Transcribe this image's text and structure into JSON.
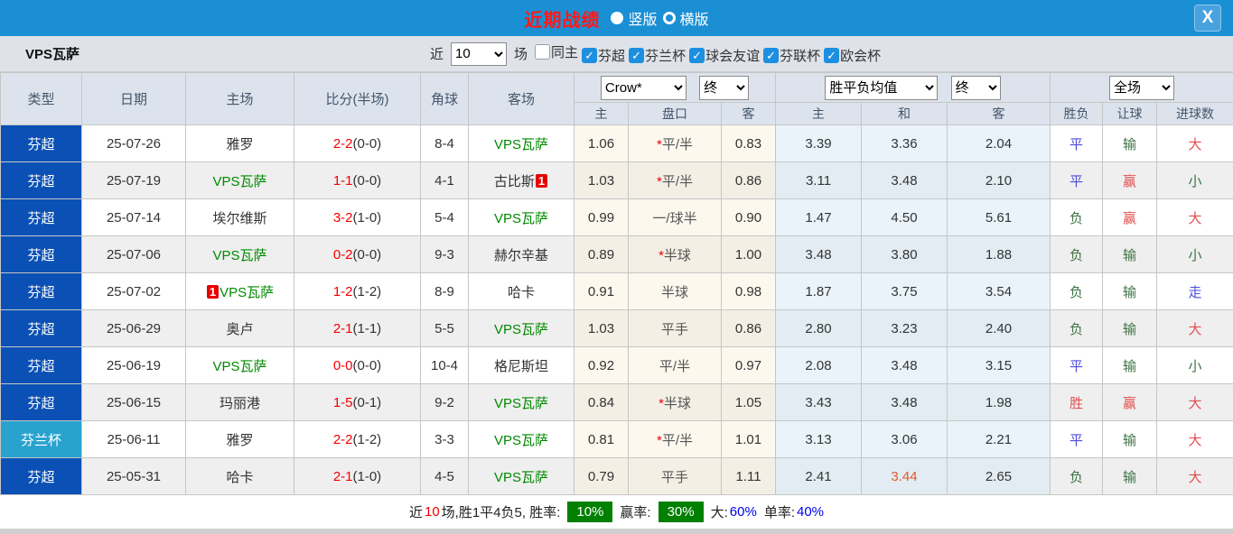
{
  "titlebar": {
    "title": "近期战绩",
    "view_options": [
      {
        "label": "竖版",
        "selected": true
      },
      {
        "label": "横版",
        "selected": false
      }
    ],
    "close_label": "X"
  },
  "filterbar": {
    "team_name": "VPS瓦萨",
    "recent_label": "近",
    "recent_count": "10",
    "matches_label": "场",
    "filters": [
      {
        "label": "同主",
        "checked": false
      },
      {
        "label": "芬超",
        "checked": true
      },
      {
        "label": "芬兰杯",
        "checked": true
      },
      {
        "label": "球会友谊",
        "checked": true
      },
      {
        "label": "芬联杯",
        "checked": true
      },
      {
        "label": "欧会杯",
        "checked": true
      }
    ]
  },
  "table": {
    "left_headers": [
      "类型",
      "日期",
      "主场",
      "比分(半场)",
      "角球",
      "客场"
    ],
    "selects": {
      "odds_company": "Crow*",
      "odds_time": "终",
      "avg": "胜平负均值",
      "avg_time": "终",
      "scope": "全场"
    },
    "sub_headers": [
      "主",
      "盘口",
      "客",
      "主",
      "和",
      "客",
      "胜负",
      "让球",
      "进球数"
    ],
    "rows": [
      {
        "league": "芬超",
        "league_color": "blue",
        "date": "25-07-26",
        "home": {
          "name": "雅罗",
          "is_team": false
        },
        "score": "2-2",
        "half": "(0-0)",
        "corners": "8-4",
        "away": {
          "name": "VPS瓦萨",
          "is_team": true
        },
        "odds_home": "1.06",
        "handicap": "平/半",
        "star": true,
        "odds_away": "0.83",
        "avg_home": "3.39",
        "avg_draw": "3.36",
        "avg_away": "2.04",
        "avg_draw_red": false,
        "wdl": {
          "text": "平",
          "c": "blue"
        },
        "let": {
          "text": "输",
          "c": "green"
        },
        "ou": {
          "text": "大",
          "c": "red"
        }
      },
      {
        "league": "芬超",
        "league_color": "blue",
        "date": "25-07-19",
        "home": {
          "name": "VPS瓦萨",
          "is_team": true
        },
        "score": "1-1",
        "half": "(0-0)",
        "corners": "4-1",
        "away": {
          "name": "古比斯",
          "is_team": false,
          "badge": "1",
          "badge_pos": "after"
        },
        "odds_home": "1.03",
        "handicap": "平/半",
        "star": true,
        "odds_away": "0.86",
        "avg_home": "3.11",
        "avg_draw": "3.48",
        "avg_away": "2.10",
        "avg_draw_red": false,
        "wdl": {
          "text": "平",
          "c": "blue"
        },
        "let": {
          "text": "赢",
          "c": "red"
        },
        "ou": {
          "text": "小",
          "c": "green"
        }
      },
      {
        "league": "芬超",
        "league_color": "blue",
        "date": "25-07-14",
        "home": {
          "name": "埃尔维斯",
          "is_team": false
        },
        "score": "3-2",
        "half": "(1-0)",
        "corners": "5-4",
        "away": {
          "name": "VPS瓦萨",
          "is_team": true
        },
        "odds_home": "0.99",
        "handicap": "一/球半",
        "star": false,
        "odds_away": "0.90",
        "avg_home": "1.47",
        "avg_draw": "4.50",
        "avg_away": "5.61",
        "avg_draw_red": false,
        "wdl": {
          "text": "负",
          "c": "green"
        },
        "let": {
          "text": "赢",
          "c": "red"
        },
        "ou": {
          "text": "大",
          "c": "red"
        }
      },
      {
        "league": "芬超",
        "league_color": "blue",
        "date": "25-07-06",
        "home": {
          "name": "VPS瓦萨",
          "is_team": true
        },
        "score": "0-2",
        "half": "(0-0)",
        "corners": "9-3",
        "away": {
          "name": "赫尔辛基",
          "is_team": false
        },
        "odds_home": "0.89",
        "handicap": "半球",
        "star": true,
        "odds_away": "1.00",
        "avg_home": "3.48",
        "avg_draw": "3.80",
        "avg_away": "1.88",
        "avg_draw_red": false,
        "wdl": {
          "text": "负",
          "c": "green"
        },
        "let": {
          "text": "输",
          "c": "green"
        },
        "ou": {
          "text": "小",
          "c": "green"
        }
      },
      {
        "league": "芬超",
        "league_color": "blue",
        "date": "25-07-02",
        "home": {
          "name": "VPS瓦萨",
          "is_team": true,
          "badge": "1",
          "badge_pos": "before"
        },
        "score": "1-2",
        "half": "(1-2)",
        "corners": "8-9",
        "away": {
          "name": "哈卡",
          "is_team": false
        },
        "odds_home": "0.91",
        "handicap": "半球",
        "star": false,
        "odds_away": "0.98",
        "avg_home": "1.87",
        "avg_draw": "3.75",
        "avg_away": "3.54",
        "avg_draw_red": false,
        "wdl": {
          "text": "负",
          "c": "green"
        },
        "let": {
          "text": "输",
          "c": "green"
        },
        "ou": {
          "text": "走",
          "c": "blue"
        }
      },
      {
        "league": "芬超",
        "league_color": "blue",
        "date": "25-06-29",
        "home": {
          "name": "奥卢",
          "is_team": false
        },
        "score": "2-1",
        "half": "(1-1)",
        "corners": "5-5",
        "away": {
          "name": "VPS瓦萨",
          "is_team": true
        },
        "odds_home": "1.03",
        "handicap": "平手",
        "star": false,
        "odds_away": "0.86",
        "avg_home": "2.80",
        "avg_draw": "3.23",
        "avg_away": "2.40",
        "avg_draw_red": false,
        "wdl": {
          "text": "负",
          "c": "green"
        },
        "let": {
          "text": "输",
          "c": "green"
        },
        "ou": {
          "text": "大",
          "c": "red"
        }
      },
      {
        "league": "芬超",
        "league_color": "blue",
        "date": "25-06-19",
        "home": {
          "name": "VPS瓦萨",
          "is_team": true
        },
        "score": "0-0",
        "half": "(0-0)",
        "corners": "10-4",
        "away": {
          "name": "格尼斯坦",
          "is_team": false
        },
        "odds_home": "0.92",
        "handicap": "平/半",
        "star": false,
        "odds_away": "0.97",
        "avg_home": "2.08",
        "avg_draw": "3.48",
        "avg_away": "3.15",
        "avg_draw_red": false,
        "wdl": {
          "text": "平",
          "c": "blue"
        },
        "let": {
          "text": "输",
          "c": "green"
        },
        "ou": {
          "text": "小",
          "c": "green"
        }
      },
      {
        "league": "芬超",
        "league_color": "blue",
        "date": "25-06-15",
        "home": {
          "name": "玛丽港",
          "is_team": false
        },
        "score": "1-5",
        "half": "(0-1)",
        "corners": "9-2",
        "away": {
          "name": "VPS瓦萨",
          "is_team": true
        },
        "odds_home": "0.84",
        "handicap": "半球",
        "star": true,
        "odds_away": "1.05",
        "avg_home": "3.43",
        "avg_draw": "3.48",
        "avg_away": "1.98",
        "avg_draw_red": false,
        "wdl": {
          "text": "胜",
          "c": "red"
        },
        "let": {
          "text": "赢",
          "c": "red"
        },
        "ou": {
          "text": "大",
          "c": "red"
        }
      },
      {
        "league": "芬兰杯",
        "league_color": "cyan",
        "date": "25-06-11",
        "home": {
          "name": "雅罗",
          "is_team": false
        },
        "score": "2-2",
        "half": "(1-2)",
        "corners": "3-3",
        "away": {
          "name": "VPS瓦萨",
          "is_team": true
        },
        "odds_home": "0.81",
        "handicap": "平/半",
        "star": true,
        "odds_away": "1.01",
        "avg_home": "3.13",
        "avg_draw": "3.06",
        "avg_away": "2.21",
        "avg_draw_red": false,
        "wdl": {
          "text": "平",
          "c": "blue"
        },
        "let": {
          "text": "输",
          "c": "green"
        },
        "ou": {
          "text": "大",
          "c": "red"
        }
      },
      {
        "league": "芬超",
        "league_color": "blue",
        "date": "25-05-31",
        "home": {
          "name": "哈卡",
          "is_team": false
        },
        "score": "2-1",
        "half": "(1-0)",
        "corners": "4-5",
        "away": {
          "name": "VPS瓦萨",
          "is_team": true
        },
        "odds_home": "0.79",
        "handicap": "平手",
        "star": false,
        "odds_away": "1.11",
        "avg_home": "2.41",
        "avg_draw": "3.44",
        "avg_away": "2.65",
        "avg_draw_red": true,
        "wdl": {
          "text": "负",
          "c": "green"
        },
        "let": {
          "text": "输",
          "c": "green"
        },
        "ou": {
          "text": "大",
          "c": "red"
        }
      }
    ]
  },
  "summary": {
    "prefix": "近",
    "count": "10",
    "mid": "场,胜1平4负5, 胜率:",
    "win_rate": "10%",
    "label2": "赢率:",
    "handicap_rate": "30%",
    "big_label": "大:",
    "big_rate": "60%",
    "odd_label": "单率:",
    "odd_rate": "40%"
  },
  "colors": {
    "titlebar_bg": "#1b8fd4",
    "league_blue": "#0b51b5",
    "league_cyan": "#28a3cf",
    "team_green": "#008a00",
    "score_red": "#f20000",
    "badge_red": "#e60000",
    "result_red": "#e05050",
    "result_green": "#3d7244",
    "result_blue": "#4d4de0",
    "avg_highlight": "#e8582a",
    "rate_badge_bg": "#008000",
    "rate_blue": "#0000ee"
  }
}
